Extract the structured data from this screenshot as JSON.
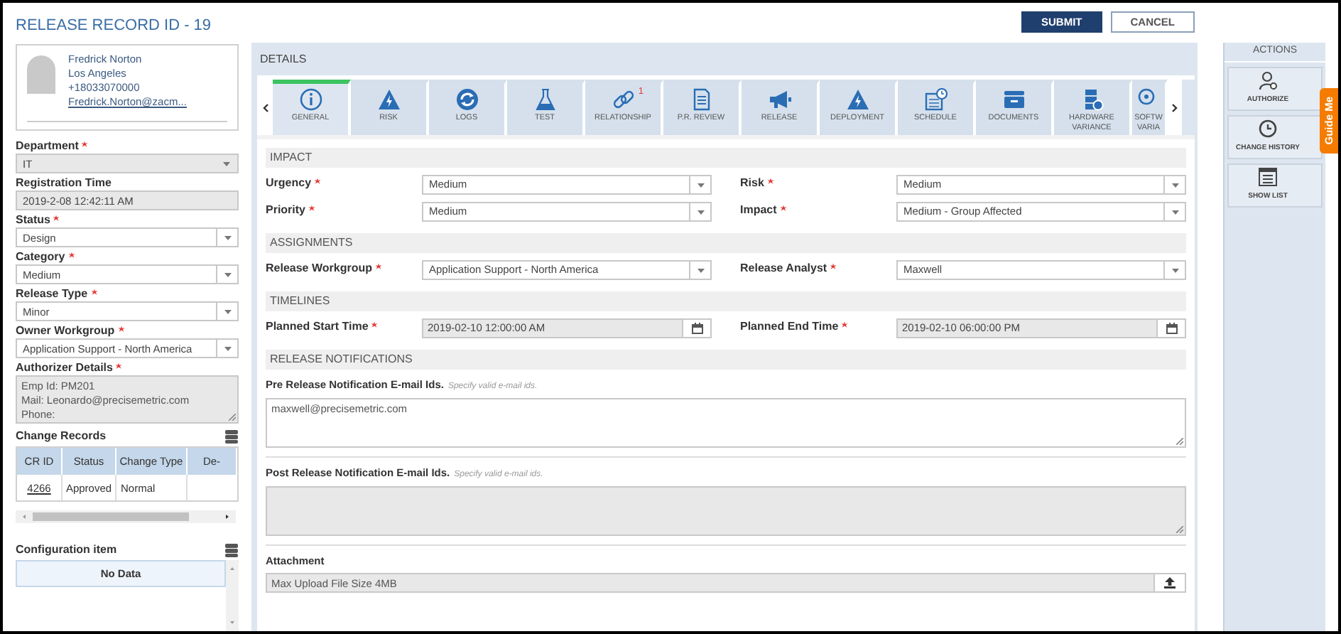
{
  "title": "RELEASE RECORD ID - 19",
  "buttons": [
    {
      "label": "SUBMIT",
      "kind": "primary"
    },
    {
      "label": "CANCEL",
      "kind": "secondary"
    }
  ],
  "requester": {
    "name": "Fredrick Norton",
    "city": "Los Angeles",
    "phone": "+18033070000",
    "email": "Fredrick.Norton@zacm..."
  },
  "left_fields": [
    {
      "kind": "select",
      "label": "Department",
      "required": true,
      "value": "IT",
      "disabled": true
    },
    {
      "kind": "text",
      "label": "Registration Time",
      "value": "2019-2-08 12:42:11 AM",
      "disabled": true
    },
    {
      "kind": "select",
      "label": "Status",
      "required": true,
      "value": "Design",
      "disabled": false
    },
    {
      "kind": "select",
      "label": "Category",
      "required": true,
      "value": "Medium",
      "disabled": false
    },
    {
      "kind": "select",
      "label": "Release Type",
      "required": true,
      "value": "Minor",
      "disabled": false
    },
    {
      "kind": "select",
      "label": "Owner Workgroup",
      "required": true,
      "value": "Application Support - North America",
      "disabled": false
    },
    {
      "kind": "textarea",
      "label": "Authorizer Details",
      "required": true,
      "lines": [
        "Emp Id: PM201",
        "Mail: Leonardo@precisemetric.com",
        "Phone:"
      ],
      "disabled": true
    }
  ],
  "change_records": {
    "title": "Change Records",
    "columns": [
      "CR ID",
      "Status",
      "Change Type",
      "De-"
    ],
    "rows": [
      {
        "cr_id": "4266",
        "status": "Approved",
        "change_type": "Normal"
      }
    ]
  },
  "configuration_item": {
    "title": "Configuration item",
    "empty_text": "No Data"
  },
  "details": {
    "title": "DETAILS",
    "tabs": [
      {
        "label": "GENERAL",
        "selected": true
      },
      {
        "label": "RISK",
        "selected": false
      },
      {
        "label": "LOGS",
        "selected": false
      },
      {
        "label": "TEST",
        "selected": false
      },
      {
        "label": "RELATIONSHIP",
        "selected": false,
        "badge": "1"
      },
      {
        "label": "P.R. REVIEW",
        "selected": false
      },
      {
        "label": "RELEASE",
        "selected": false
      },
      {
        "label": "DEPLOYMENT",
        "selected": false
      },
      {
        "label": "SCHEDULE",
        "selected": false
      },
      {
        "label": "DOCUMENTS",
        "selected": false
      },
      {
        "label": "HARDWARE VARIANCE",
        "selected": false
      },
      {
        "label": "SOFTW VARIA",
        "selected": false
      }
    ]
  },
  "sections": [
    {
      "title": "IMPACT",
      "fields": [
        {
          "kind": "select",
          "label": "Urgency",
          "required": true,
          "value": "Medium",
          "disabled": false
        },
        {
          "kind": "select",
          "label": "Risk",
          "required": true,
          "value": "Medium",
          "disabled": false
        },
        {
          "kind": "select",
          "label": "Priority",
          "required": true,
          "value": "Medium",
          "disabled": false
        },
        {
          "kind": "select",
          "label": "Impact",
          "required": true,
          "value": "Medium - Group Affected",
          "disabled": false
        }
      ]
    },
    {
      "title": "ASSIGNMENTS",
      "fields": [
        {
          "kind": "select",
          "label": "Release Workgroup",
          "required": true,
          "value": "Application Support - North America",
          "disabled": false
        },
        {
          "kind": "select",
          "label": "Release Analyst",
          "required": true,
          "value": "Maxwell",
          "disabled": false
        }
      ]
    },
    {
      "title": "TIMELINES",
      "fields": [
        {
          "kind": "date",
          "label": "Planned Start Time",
          "required": true,
          "value": "2019-02-10 12:00:00 AM",
          "disabled": true
        },
        {
          "kind": "date",
          "label": "Planned End Time",
          "required": true,
          "value": "2019-02-10 06:00:00 PM",
          "disabled": true
        }
      ]
    },
    {
      "title": "RELEASE NOTIFICATIONS",
      "fields": [
        {
          "kind": "textarea",
          "label": "Pre Release Notification E-mail Ids.",
          "hint": "Specify valid e-mail ids.",
          "value": "maxwell@precisemetric.com",
          "disabled": false
        },
        {
          "kind": "textarea",
          "label": "Post Release Notification E-mail Ids.",
          "hint": "Specify valid e-mail ids.",
          "disabled": true
        },
        {
          "kind": "file",
          "label": "Attachment",
          "placeholder": "Max Upload File Size 4MB"
        }
      ]
    }
  ],
  "actions": {
    "title": "ACTIONS",
    "items": [
      {
        "label": "AUTHORIZE"
      },
      {
        "label": "CHANGE HISTORY"
      },
      {
        "label": "SHOW LIST"
      }
    ]
  },
  "guide_tab": "Guide Me"
}
